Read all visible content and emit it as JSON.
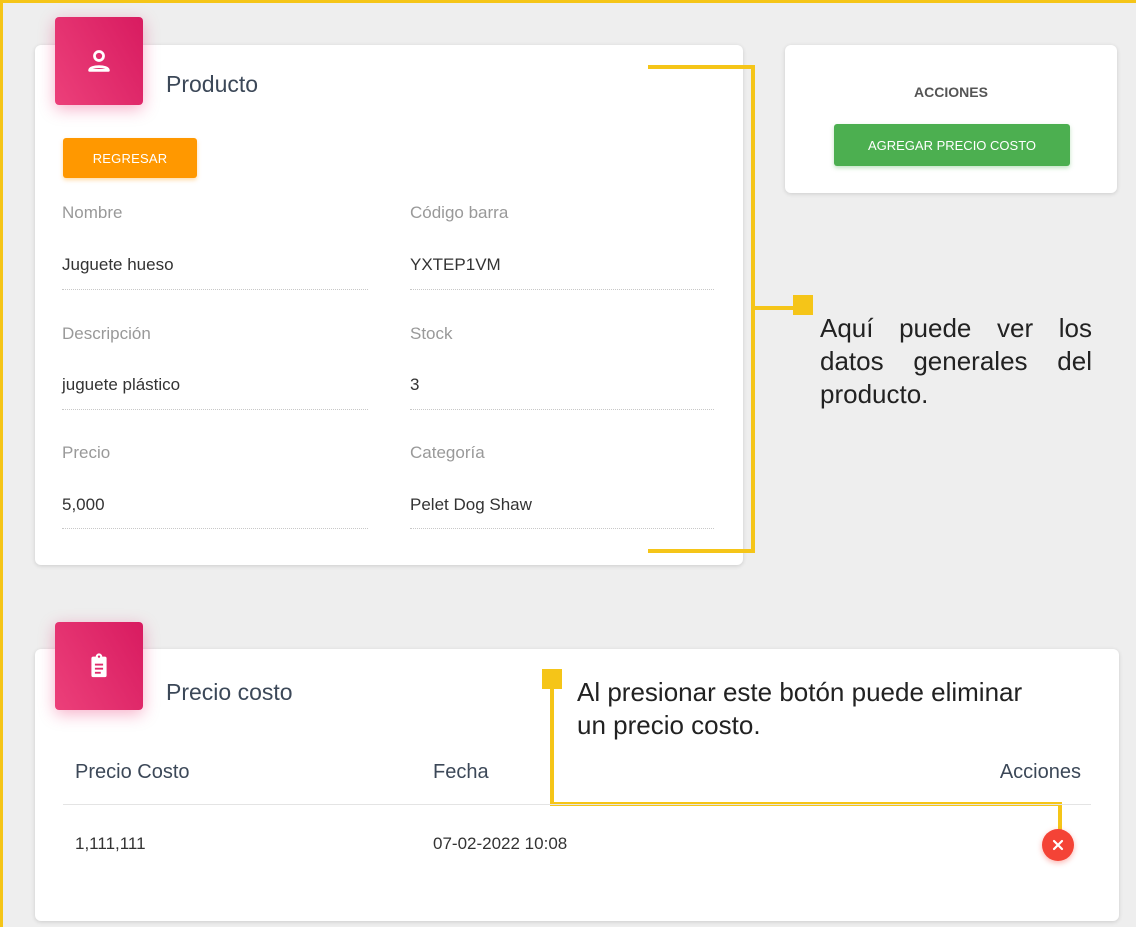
{
  "product_card": {
    "title": "Producto",
    "icon": "user-icon",
    "back_button": "REGRESAR",
    "fields": [
      {
        "label": "Nombre",
        "value": "Juguete hueso"
      },
      {
        "label": "Código barra",
        "value": "YXTEP1VM"
      },
      {
        "label": "Descripción",
        "value": "juguete plástico"
      },
      {
        "label": "Stock",
        "value": "3"
      },
      {
        "label": "Precio",
        "value": "5,000"
      },
      {
        "label": "Categoría",
        "value": "Pelet Dog Shaw"
      }
    ]
  },
  "actions_card": {
    "title": "ACCIONES",
    "add_button": "AGREGAR PRECIO COSTO"
  },
  "cost_card": {
    "title": "Precio costo",
    "icon": "clipboard-icon",
    "columns": [
      "Precio Costo",
      "Fecha",
      "Acciones"
    ],
    "rows": [
      {
        "precio": "1,111,111",
        "fecha": "07-02-2022 10:08"
      }
    ],
    "delete_icon": "close-icon"
  },
  "annotations": {
    "general": [
      "Aquí puede ver los",
      "datos generales del",
      "producto."
    ],
    "delete": [
      "Al presionar este botón puede eliminar",
      "un precio costo."
    ]
  },
  "colors": {
    "accent_yellow": "#f5c518",
    "pink": "#e91e63",
    "orange": "#ff9800",
    "green": "#4caf50",
    "red": "#f44336"
  }
}
